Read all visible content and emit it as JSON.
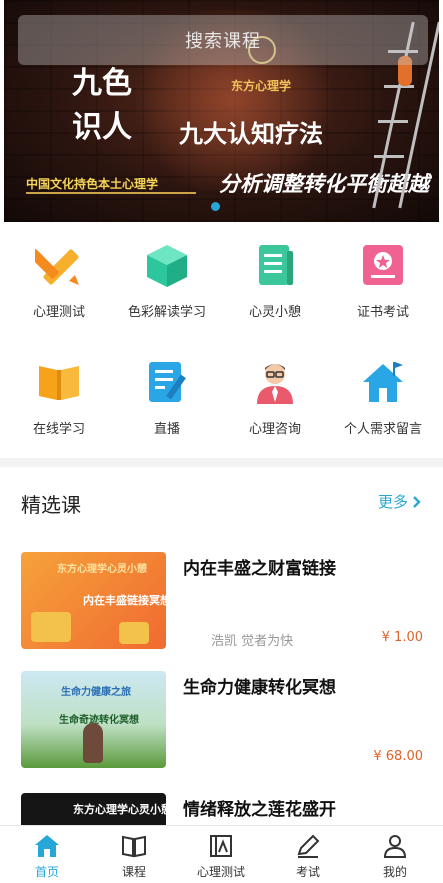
{
  "banner": {
    "search_placeholder": "搜索课程",
    "brand": "东方心理学",
    "title_line1": "九色",
    "title_line2": "识人",
    "subtitle": "九大认知疗法",
    "slogan": "分析调整转化平衡超越",
    "tagline": "中国文化持色本土心理学"
  },
  "grid": {
    "items": [
      {
        "label": "心理测试",
        "icon": "ruler-pencil-icon"
      },
      {
        "label": "色彩解读学习",
        "icon": "cube-icon"
      },
      {
        "label": "心灵小憩",
        "icon": "notebook-icon"
      },
      {
        "label": "证书考试",
        "icon": "certificate-icon"
      },
      {
        "label": "在线学习",
        "icon": "open-book-icon"
      },
      {
        "label": "直播",
        "icon": "edit-document-icon"
      },
      {
        "label": "心理咨询",
        "icon": "counselor-icon"
      },
      {
        "label": "个人需求留言",
        "icon": "home-flag-icon"
      }
    ]
  },
  "section": {
    "title": "精选课",
    "more": "更多"
  },
  "courses": [
    {
      "title": "内在丰盛之财富链接",
      "author": "浩凯 觉者为快",
      "price": "¥ 1.00",
      "thumb_top": "东方心理学心灵小憩",
      "thumb_caption": "内在丰盛链接冥想"
    },
    {
      "title": "生命力健康转化冥想",
      "author": "",
      "price": "¥ 68.00",
      "thumb_top": "生命力健康之旅",
      "thumb_caption": "生命奇迹转化冥想"
    },
    {
      "title": "情绪释放之莲花盛开",
      "author": "",
      "price": "",
      "thumb_top": "东方心理学心灵小憩",
      "thumb_caption": ""
    }
  ],
  "tabbar": {
    "items": [
      {
        "label": "首页",
        "icon": "home-icon"
      },
      {
        "label": "课程",
        "icon": "book-icon"
      },
      {
        "label": "心理测试",
        "icon": "test-icon"
      },
      {
        "label": "考试",
        "icon": "pencil-icon"
      },
      {
        "label": "我的",
        "icon": "user-icon"
      }
    ],
    "active_color": "#27a7d8"
  }
}
